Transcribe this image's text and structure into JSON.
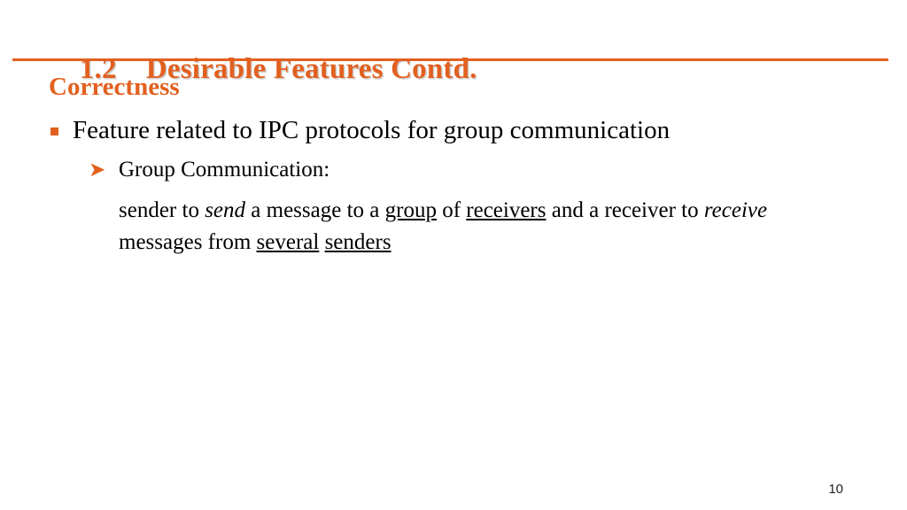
{
  "slide": {
    "accent_color": "#E2601F",
    "text_color": "#000000",
    "background_color": "#FFFFFF",
    "title": {
      "number": "1.2",
      "text": "Desirable Features Contd."
    },
    "section_heading": "Correctness",
    "bullets": {
      "level1": {
        "marker": "square-bullet-icon",
        "text": "Feature related to IPC protocols for group communication"
      },
      "level2": {
        "marker": "arrow-bullet-icon",
        "text": "Group Communication:"
      }
    },
    "paragraph": {
      "p1": "sender to ",
      "p2_italic": "send",
      "p3": " a message to a ",
      "p4_underline": "group",
      "p5": " of ",
      "p6_underline": "receivers",
      "p7": " and a receiver to ",
      "p8_italic": "receive",
      "p9": " messages from ",
      "p10_underline": "several",
      "p11": " ",
      "p12_underline": "senders"
    },
    "page_number": "10"
  }
}
